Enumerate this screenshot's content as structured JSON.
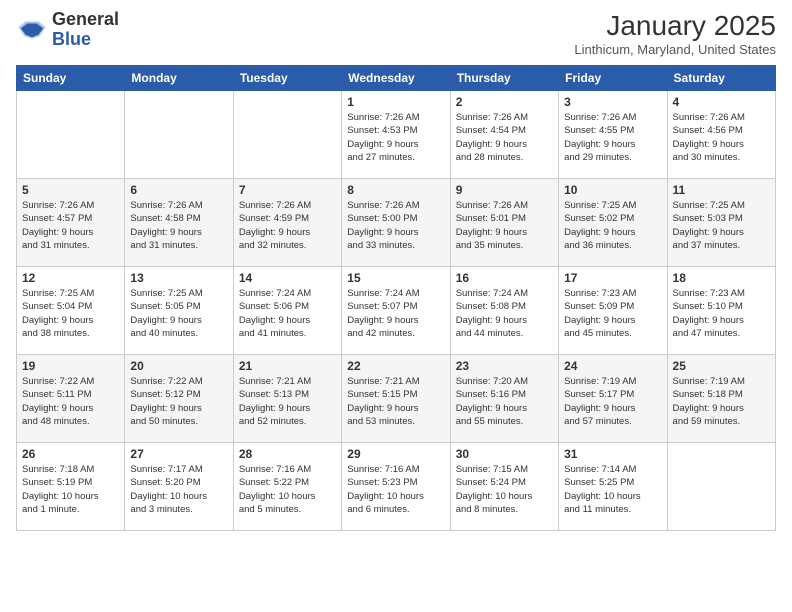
{
  "header": {
    "logo_general": "General",
    "logo_blue": "Blue",
    "month_title": "January 2025",
    "location": "Linthicum, Maryland, United States"
  },
  "weekdays": [
    "Sunday",
    "Monday",
    "Tuesday",
    "Wednesday",
    "Thursday",
    "Friday",
    "Saturday"
  ],
  "weeks": [
    [
      {
        "day": "",
        "info": ""
      },
      {
        "day": "",
        "info": ""
      },
      {
        "day": "",
        "info": ""
      },
      {
        "day": "1",
        "info": "Sunrise: 7:26 AM\nSunset: 4:53 PM\nDaylight: 9 hours\nand 27 minutes."
      },
      {
        "day": "2",
        "info": "Sunrise: 7:26 AM\nSunset: 4:54 PM\nDaylight: 9 hours\nand 28 minutes."
      },
      {
        "day": "3",
        "info": "Sunrise: 7:26 AM\nSunset: 4:55 PM\nDaylight: 9 hours\nand 29 minutes."
      },
      {
        "day": "4",
        "info": "Sunrise: 7:26 AM\nSunset: 4:56 PM\nDaylight: 9 hours\nand 30 minutes."
      }
    ],
    [
      {
        "day": "5",
        "info": "Sunrise: 7:26 AM\nSunset: 4:57 PM\nDaylight: 9 hours\nand 31 minutes."
      },
      {
        "day": "6",
        "info": "Sunrise: 7:26 AM\nSunset: 4:58 PM\nDaylight: 9 hours\nand 31 minutes."
      },
      {
        "day": "7",
        "info": "Sunrise: 7:26 AM\nSunset: 4:59 PM\nDaylight: 9 hours\nand 32 minutes."
      },
      {
        "day": "8",
        "info": "Sunrise: 7:26 AM\nSunset: 5:00 PM\nDaylight: 9 hours\nand 33 minutes."
      },
      {
        "day": "9",
        "info": "Sunrise: 7:26 AM\nSunset: 5:01 PM\nDaylight: 9 hours\nand 35 minutes."
      },
      {
        "day": "10",
        "info": "Sunrise: 7:25 AM\nSunset: 5:02 PM\nDaylight: 9 hours\nand 36 minutes."
      },
      {
        "day": "11",
        "info": "Sunrise: 7:25 AM\nSunset: 5:03 PM\nDaylight: 9 hours\nand 37 minutes."
      }
    ],
    [
      {
        "day": "12",
        "info": "Sunrise: 7:25 AM\nSunset: 5:04 PM\nDaylight: 9 hours\nand 38 minutes."
      },
      {
        "day": "13",
        "info": "Sunrise: 7:25 AM\nSunset: 5:05 PM\nDaylight: 9 hours\nand 40 minutes."
      },
      {
        "day": "14",
        "info": "Sunrise: 7:24 AM\nSunset: 5:06 PM\nDaylight: 9 hours\nand 41 minutes."
      },
      {
        "day": "15",
        "info": "Sunrise: 7:24 AM\nSunset: 5:07 PM\nDaylight: 9 hours\nand 42 minutes."
      },
      {
        "day": "16",
        "info": "Sunrise: 7:24 AM\nSunset: 5:08 PM\nDaylight: 9 hours\nand 44 minutes."
      },
      {
        "day": "17",
        "info": "Sunrise: 7:23 AM\nSunset: 5:09 PM\nDaylight: 9 hours\nand 45 minutes."
      },
      {
        "day": "18",
        "info": "Sunrise: 7:23 AM\nSunset: 5:10 PM\nDaylight: 9 hours\nand 47 minutes."
      }
    ],
    [
      {
        "day": "19",
        "info": "Sunrise: 7:22 AM\nSunset: 5:11 PM\nDaylight: 9 hours\nand 48 minutes."
      },
      {
        "day": "20",
        "info": "Sunrise: 7:22 AM\nSunset: 5:12 PM\nDaylight: 9 hours\nand 50 minutes."
      },
      {
        "day": "21",
        "info": "Sunrise: 7:21 AM\nSunset: 5:13 PM\nDaylight: 9 hours\nand 52 minutes."
      },
      {
        "day": "22",
        "info": "Sunrise: 7:21 AM\nSunset: 5:15 PM\nDaylight: 9 hours\nand 53 minutes."
      },
      {
        "day": "23",
        "info": "Sunrise: 7:20 AM\nSunset: 5:16 PM\nDaylight: 9 hours\nand 55 minutes."
      },
      {
        "day": "24",
        "info": "Sunrise: 7:19 AM\nSunset: 5:17 PM\nDaylight: 9 hours\nand 57 minutes."
      },
      {
        "day": "25",
        "info": "Sunrise: 7:19 AM\nSunset: 5:18 PM\nDaylight: 9 hours\nand 59 minutes."
      }
    ],
    [
      {
        "day": "26",
        "info": "Sunrise: 7:18 AM\nSunset: 5:19 PM\nDaylight: 10 hours\nand 1 minute."
      },
      {
        "day": "27",
        "info": "Sunrise: 7:17 AM\nSunset: 5:20 PM\nDaylight: 10 hours\nand 3 minutes."
      },
      {
        "day": "28",
        "info": "Sunrise: 7:16 AM\nSunset: 5:22 PM\nDaylight: 10 hours\nand 5 minutes."
      },
      {
        "day": "29",
        "info": "Sunrise: 7:16 AM\nSunset: 5:23 PM\nDaylight: 10 hours\nand 6 minutes."
      },
      {
        "day": "30",
        "info": "Sunrise: 7:15 AM\nSunset: 5:24 PM\nDaylight: 10 hours\nand 8 minutes."
      },
      {
        "day": "31",
        "info": "Sunrise: 7:14 AM\nSunset: 5:25 PM\nDaylight: 10 hours\nand 11 minutes."
      },
      {
        "day": "",
        "info": ""
      }
    ]
  ]
}
